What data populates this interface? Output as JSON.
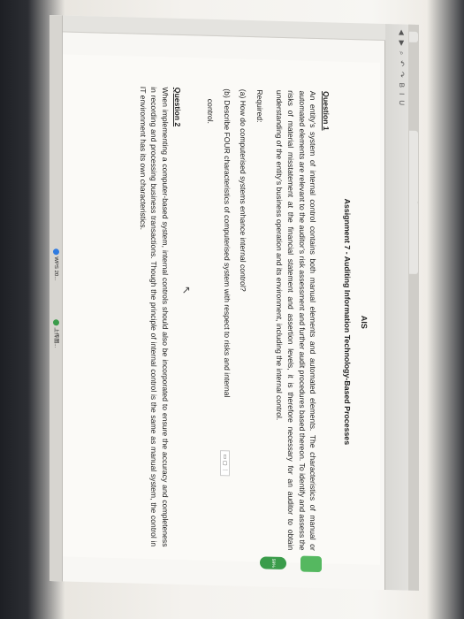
{
  "document": {
    "course": "AIS",
    "assignment_title": "Assignment 7 - Auditing Information Technology-Based Processes",
    "question1": {
      "heading": "Question 1",
      "paragraph": "An entity’s system of internal control contains both manual elements and automated elements. The characteristics of manual or automated elements are relevant to the auditor’s risk assessment and further audit procedures based thereon. To identify and assess the risks of material misstatement at the financial statement and assertion levels, it is therefore necessary for an auditor to obtain understanding of the entity’s business operation and its environment, including the internal control.",
      "required_label": "Required:",
      "part_a": "(a) How do computerised systems enhance internal control?",
      "part_b_line1": "(b) Describe FOUR characteristics of computerised system with respect to risks and internal",
      "part_b_line2": "control."
    },
    "question2": {
      "heading": "Question 2",
      "paragraph": "When implementing a computer-based system, internal controls should also be incorporated to ensure the accuracy and completeness in recording and processing business transactions. Though the principle of internal control is the same as manual system, the control in IT environment has its own characteristics."
    }
  },
  "ui": {
    "zoom_chip": "59%",
    "taskbar_items": [
      "WPS 20...",
      "上传图..."
    ],
    "colors": {
      "accent_green": "#3a9c4a",
      "page_bg": "#fbfaf7",
      "text": "#222222"
    },
    "icons": [
      "cursor-icon",
      "back-icon",
      "forward-icon",
      "search-icon"
    ]
  }
}
